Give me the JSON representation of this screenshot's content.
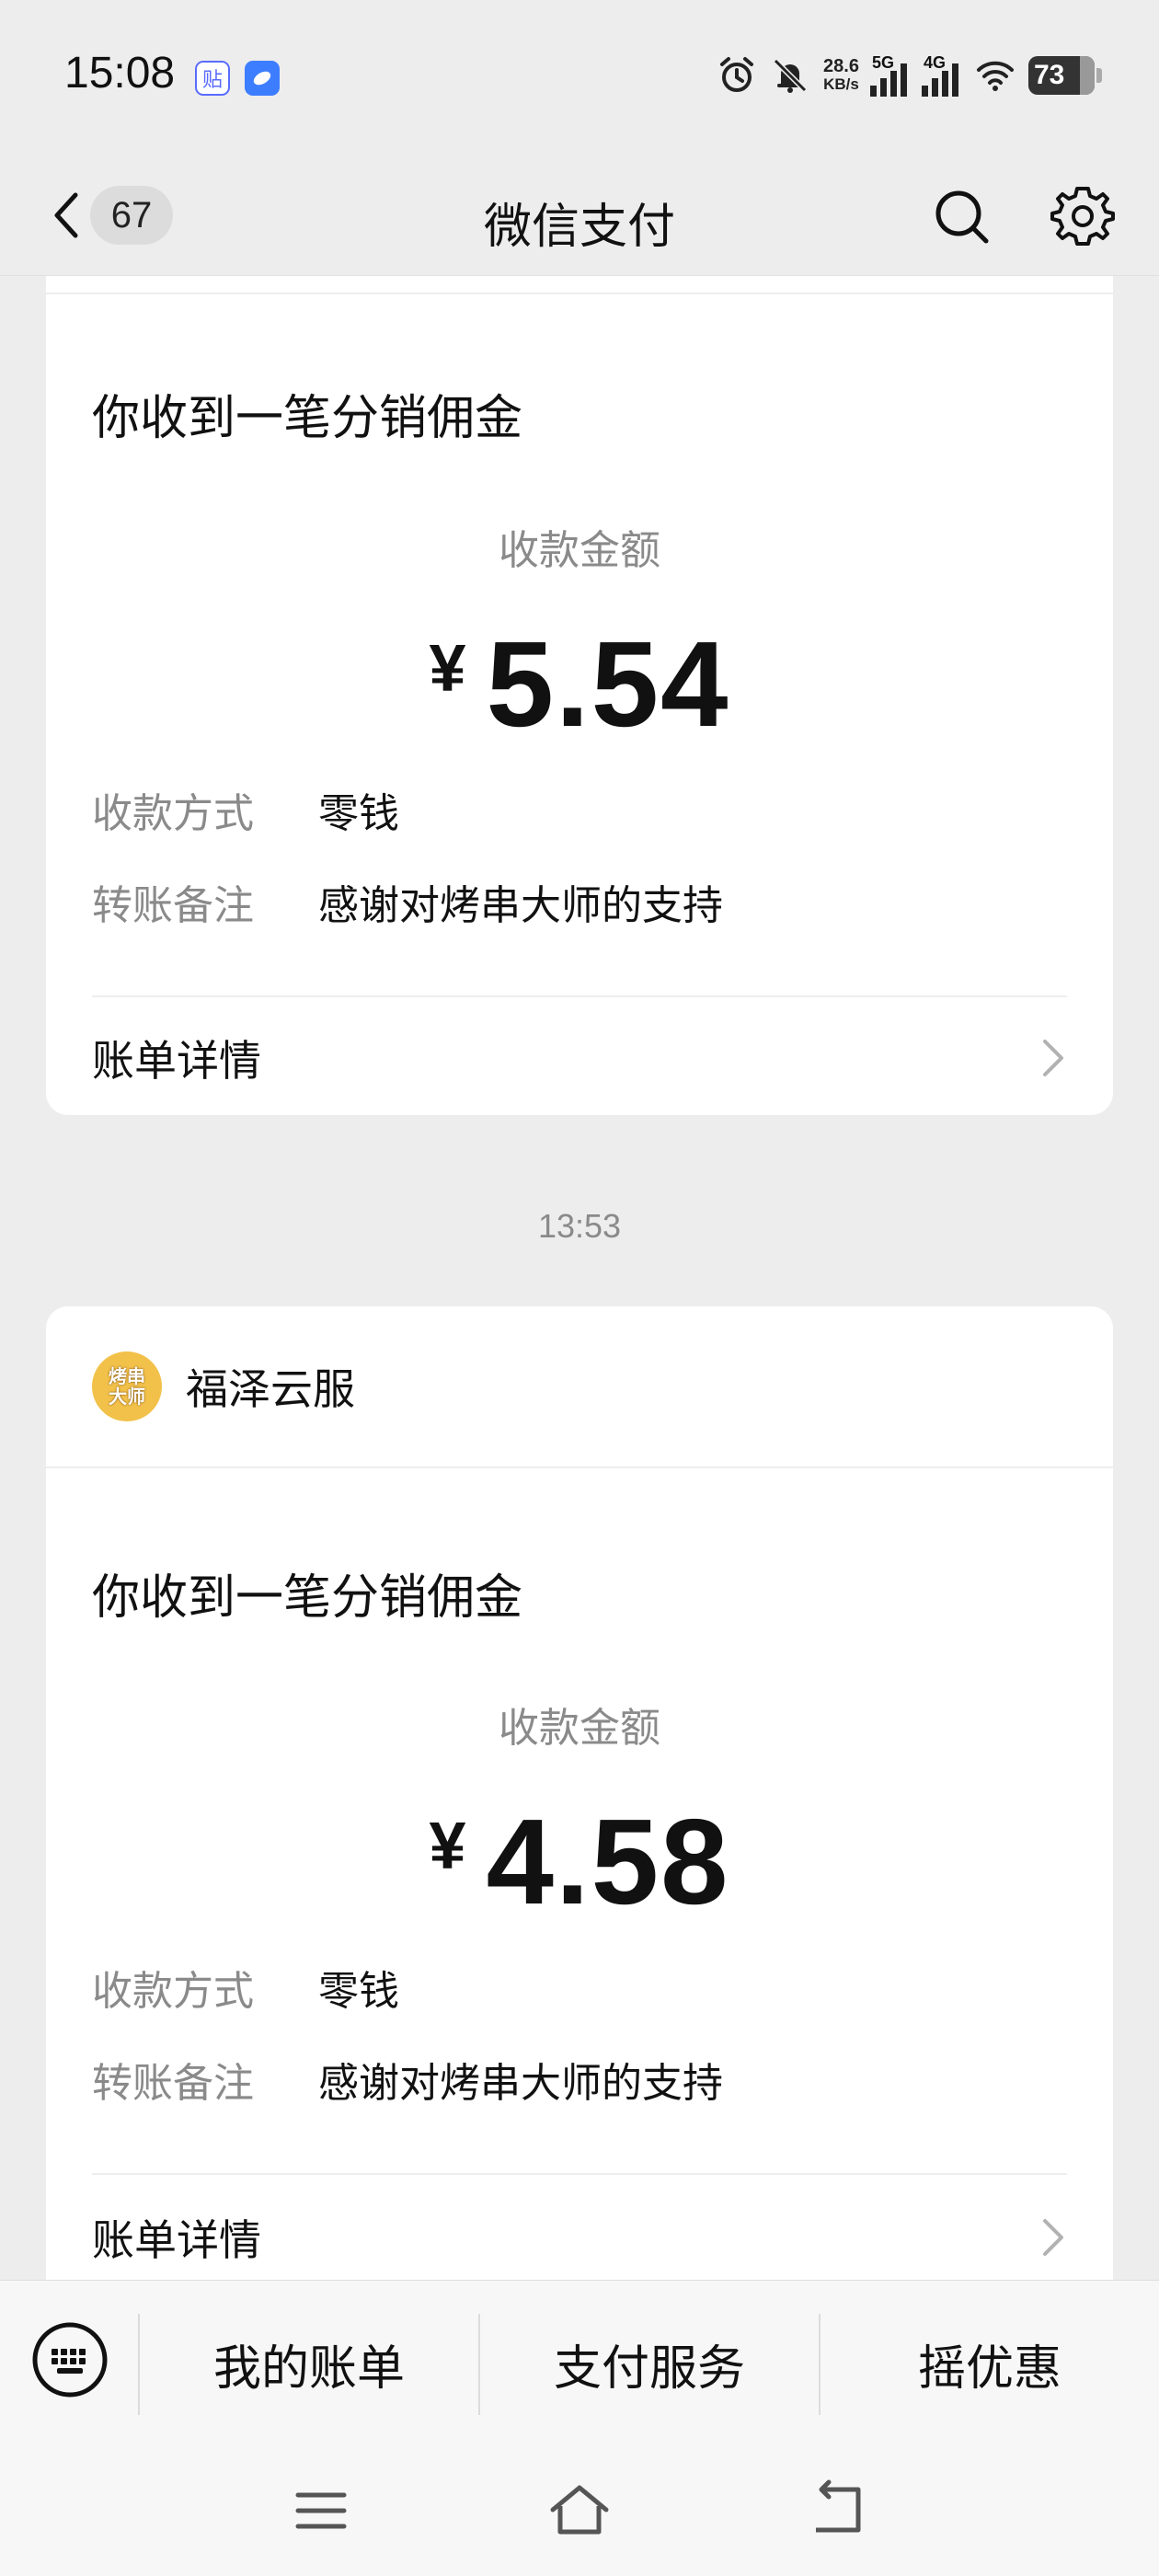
{
  "status_bar": {
    "time": "15:08",
    "app_icon_1": "贴",
    "net_speed_value": "28.6",
    "net_speed_unit": "KB/s",
    "signal_1_label": "5G",
    "signal_2_label": "4G",
    "battery": "73",
    "icons": [
      "alarm-icon",
      "mute-icon",
      "signal-icon",
      "wifi-icon",
      "battery-icon"
    ]
  },
  "nav": {
    "unread_count": "67",
    "title": "微信支付"
  },
  "messages": [
    {
      "title": "你收到一笔分销佣金",
      "amount_label": "收款金额",
      "currency": "¥",
      "amount": "5.54",
      "method_key": "收款方式",
      "method_value": "零钱",
      "note_key": "转账备注",
      "note_value": "感谢对烤串大师的支持",
      "detail_label": "账单详情"
    },
    {
      "timestamp": "13:53",
      "merchant_logo_text": "烤串大师",
      "merchant_name": "福泽云服",
      "title": "你收到一笔分销佣金",
      "amount_label": "收款金额",
      "currency": "¥",
      "amount": "4.58",
      "method_key": "收款方式",
      "method_value": "零钱",
      "note_key": "转账备注",
      "note_value": "感谢对烤串大师的支持",
      "detail_label": "账单详情"
    }
  ],
  "bottom_menu": {
    "items": [
      "我的账单",
      "支付服务",
      "摇优惠"
    ]
  },
  "colors": {
    "background": "#ededed",
    "card": "#ffffff",
    "secondary_text": "#8a8a8a",
    "primary_text": "#111111"
  }
}
